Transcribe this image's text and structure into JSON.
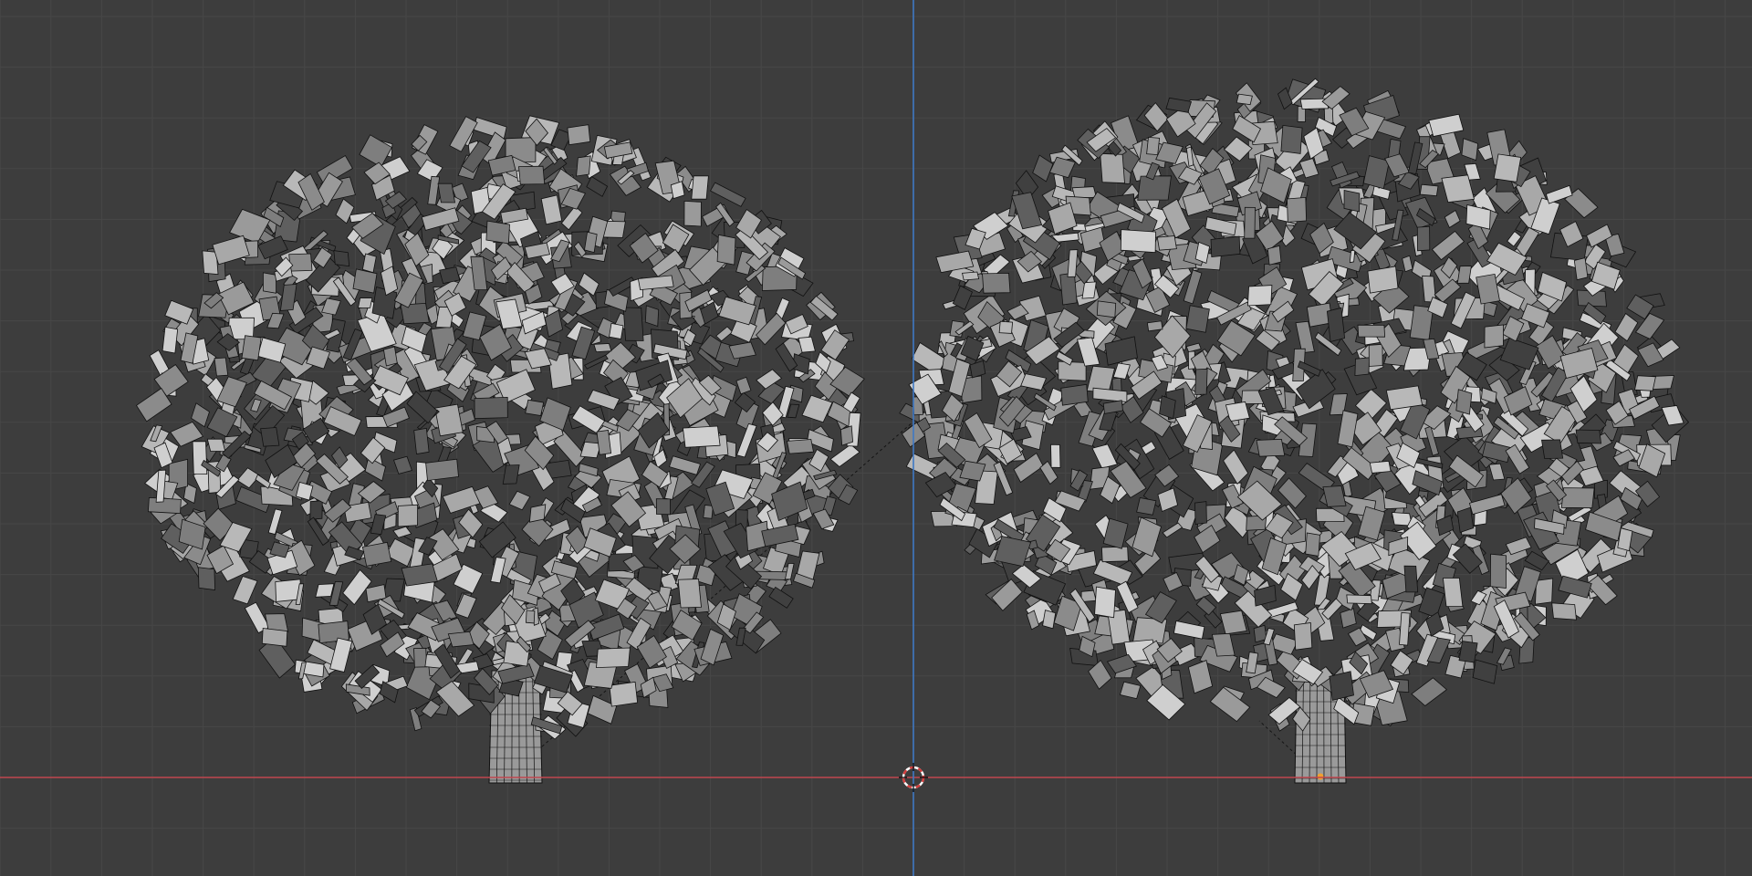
{
  "viewport": {
    "view": "front-orthographic",
    "grid_visible": true,
    "background_color": "#3d3d3d",
    "grid_minor_color": "#474747",
    "axis_x_color": "#c0474f",
    "axis_z_color": "#3e78c4",
    "wire_color": "#111111",
    "leaf_colors": [
      "#9a9a9a",
      "#b8b8b8",
      "#7e7e7e",
      "#cfcfcf",
      "#8b8b8b",
      "#5f5f5f",
      "#a8a8a8",
      "#404040"
    ],
    "origin_dot_color": "#f0a030"
  },
  "scene": {
    "objects": [
      {
        "name": "tree-left",
        "type": "mesh",
        "shading": "solid-wireframe"
      },
      {
        "name": "tree-right",
        "type": "mesh",
        "shading": "solid-wireframe",
        "selected_origin_visible": true
      }
    ],
    "cursor_3d": {
      "icon": "3d-cursor-icon"
    },
    "relationship_lines": true
  }
}
